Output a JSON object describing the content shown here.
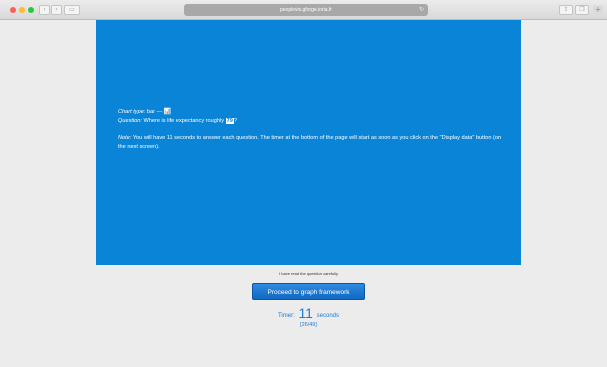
{
  "browser": {
    "url": "peoplevis.gforge.inria.fr",
    "back_icon": "chevron-left-icon",
    "forward_icon": "chevron-right-icon",
    "reload_icon": "reload-icon"
  },
  "panel": {
    "background_color": "#0a84d6",
    "chart_type_label": "Chart type:",
    "chart_type_value": " bar — ",
    "chart_type_icon": "bar-chart-icon",
    "question_label": "Question:",
    "question_text": " Where is life expectancy roughly ",
    "question_value": "79",
    "question_end": "?",
    "note_label": "Note:",
    "note_text": " You will have 11 seconds to answer each question. The timer at the bottom of the page will start as soon as you click on the \"Display data\" button (on the next screen)."
  },
  "acknowledgement": "I have read the question carefully",
  "proceed_button": "Proceed to graph framework",
  "timer": {
    "label": "Timer:",
    "value": "11",
    "unit": "seconds"
  },
  "progress": "[26/49]"
}
